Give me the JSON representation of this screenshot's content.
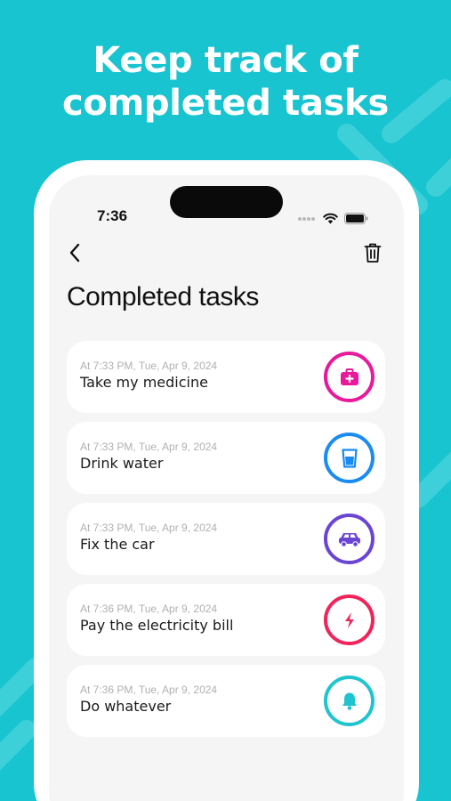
{
  "headline": {
    "line1": "Keep track of",
    "line2": "completed tasks"
  },
  "colors": {
    "background": "#17c4cf",
    "pink": "#e8199a",
    "blue": "#1a8cf0",
    "purple": "#6a45d4",
    "red": "#f0245a",
    "teal": "#20c4cf"
  },
  "status_bar": {
    "time": "7:36"
  },
  "page": {
    "title": "Completed tasks"
  },
  "tasks": [
    {
      "time": "At 7:33 PM, Tue, Apr 9, 2024",
      "title": "Take my medicine",
      "icon": "medical-kit-icon",
      "color": "#e8199a"
    },
    {
      "time": "At 7:33 PM, Tue, Apr 9, 2024",
      "title": "Drink water",
      "icon": "water-glass-icon",
      "color": "#1a8cf0"
    },
    {
      "time": "At 7:33 PM, Tue, Apr 9, 2024",
      "title": "Fix the car",
      "icon": "car-icon",
      "color": "#6a45d4"
    },
    {
      "time": "At 7:36 PM, Tue, Apr 9, 2024",
      "title": "Pay the electricity bill",
      "icon": "lightning-icon",
      "color": "#f0245a"
    },
    {
      "time": "At 7:36 PM, Tue, Apr 9, 2024",
      "title": "Do whatever",
      "icon": "bell-icon",
      "color": "#20c4cf"
    }
  ]
}
